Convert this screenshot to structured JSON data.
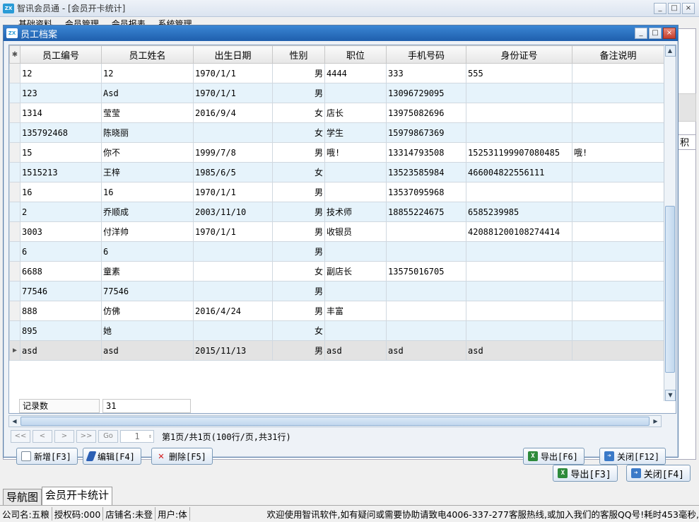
{
  "main": {
    "title": "智讯会员通 - [会员开卡统计]",
    "menu": [
      "基础资料",
      "会员管理",
      "会员报表",
      "系统管理"
    ],
    "right_tab_label": "积分",
    "export_label": "导出[F3]",
    "close_label": "关闭[F4]",
    "bottom_tabs": [
      "导航图",
      "会员开卡统计"
    ],
    "status": {
      "company": "公司名:五粮",
      "auth": "授权码:000",
      "shop": "店铺名:未登",
      "user": "用户:体",
      "message": "欢迎使用智讯软件,如有疑问或需要协助请致电4006-337-277客服热线,或加入我们的客服QQ号!耗时453毫秒,"
    }
  },
  "dialog": {
    "title": "员工档案",
    "columns": [
      "员工编号",
      "员工姓名",
      "出生日期",
      "性别",
      "职位",
      "手机号码",
      "身份证号",
      "备注说明"
    ],
    "rows": [
      [
        "12",
        "12",
        "1970/1/1",
        "男",
        "4444",
        "333",
        "555",
        ""
      ],
      [
        "123",
        "Asd",
        "1970/1/1",
        "男",
        "",
        "13096729095",
        "",
        ""
      ],
      [
        "1314",
        "莹莹",
        "2016/9/4",
        "女",
        "店长",
        "13975082696",
        "",
        ""
      ],
      [
        "135792468",
        "陈晓丽",
        "",
        "女",
        "学生",
        "15979867369",
        "",
        ""
      ],
      [
        "15",
        "你不",
        "1999/7/8",
        "男",
        "哦!",
        "13314793508",
        "152531199907080485",
        "哦!"
      ],
      [
        "1515213",
        "王梓",
        "1985/6/5",
        "女",
        "",
        "13523585984",
        "466004822556111",
        ""
      ],
      [
        "16",
        "16",
        "1970/1/1",
        "男",
        "",
        "13537095968",
        "",
        ""
      ],
      [
        "2",
        "乔顺成",
        "2003/11/10",
        "男",
        "技术师",
        "18855224675",
        "6585239985",
        ""
      ],
      [
        "3003",
        "付洋帅",
        "1970/1/1",
        "男",
        "收银员",
        "",
        "420881200108274414",
        ""
      ],
      [
        "6",
        "6",
        "",
        "男",
        "",
        "",
        "",
        ""
      ],
      [
        "6688",
        "童素",
        "",
        "女",
        "副店长",
        "13575016705",
        "",
        ""
      ],
      [
        "77546",
        "77546",
        "",
        "男",
        "",
        "",
        "",
        ""
      ],
      [
        "888",
        "仿佛",
        "2016/4/24",
        "男",
        "丰富",
        "",
        "",
        ""
      ],
      [
        "895",
        "她",
        "",
        "女",
        "",
        "",
        "",
        ""
      ],
      [
        "asd",
        "asd",
        "2015/11/13",
        "男",
        "asd",
        "asd",
        "asd",
        ""
      ]
    ],
    "record_label": "记录数",
    "record_count": "31",
    "pager": {
      "first": "<<",
      "prev": "<",
      "next": ">",
      "last": ">>",
      "go": "Go",
      "page": "1",
      "info": "第1页/共1页(100行/页,共31行)"
    },
    "buttons": {
      "add": "新增[F3]",
      "edit": "编辑[F4]",
      "delete": "删除[F5]",
      "export": "导出[F6]",
      "close": "关闭[F12]"
    }
  }
}
